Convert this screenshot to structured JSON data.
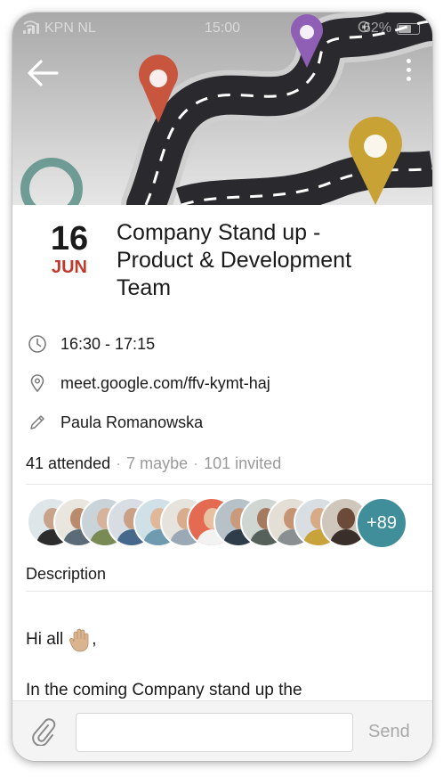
{
  "status_bar": {
    "carrier": "KPN NL",
    "time": "15:00",
    "battery": "62%"
  },
  "header": {
    "back_icon": "arrow-left-icon",
    "menu_icon": "more-vertical-icon"
  },
  "event": {
    "day": "16",
    "month": "JUN",
    "title_lines": [
      "Company Stand up -",
      "Product & Development",
      "Team"
    ],
    "time": "16:30 - 17:15",
    "location": "meet.google.com/ffv-kymt-haj",
    "organizer": "Paula Romanowska"
  },
  "attendance": {
    "attended": "41 attended",
    "sep1": "·",
    "maybe": "7 maybe",
    "sep2": "·",
    "invited": "101 invited"
  },
  "avatars": {
    "more_count": "+89"
  },
  "description": {
    "label": "Description",
    "greeting": "Hi all",
    "emoji_icon": "raised-hand-icon",
    "greeting_suffix": ",",
    "body": "In the coming Company stand up the"
  },
  "compose": {
    "placeholder": "",
    "send_label": "Send"
  },
  "colors": {
    "accent_red": "#c0392b",
    "avatar_more_bg": "#3f8e9a",
    "muted": "#9a9a9a"
  }
}
